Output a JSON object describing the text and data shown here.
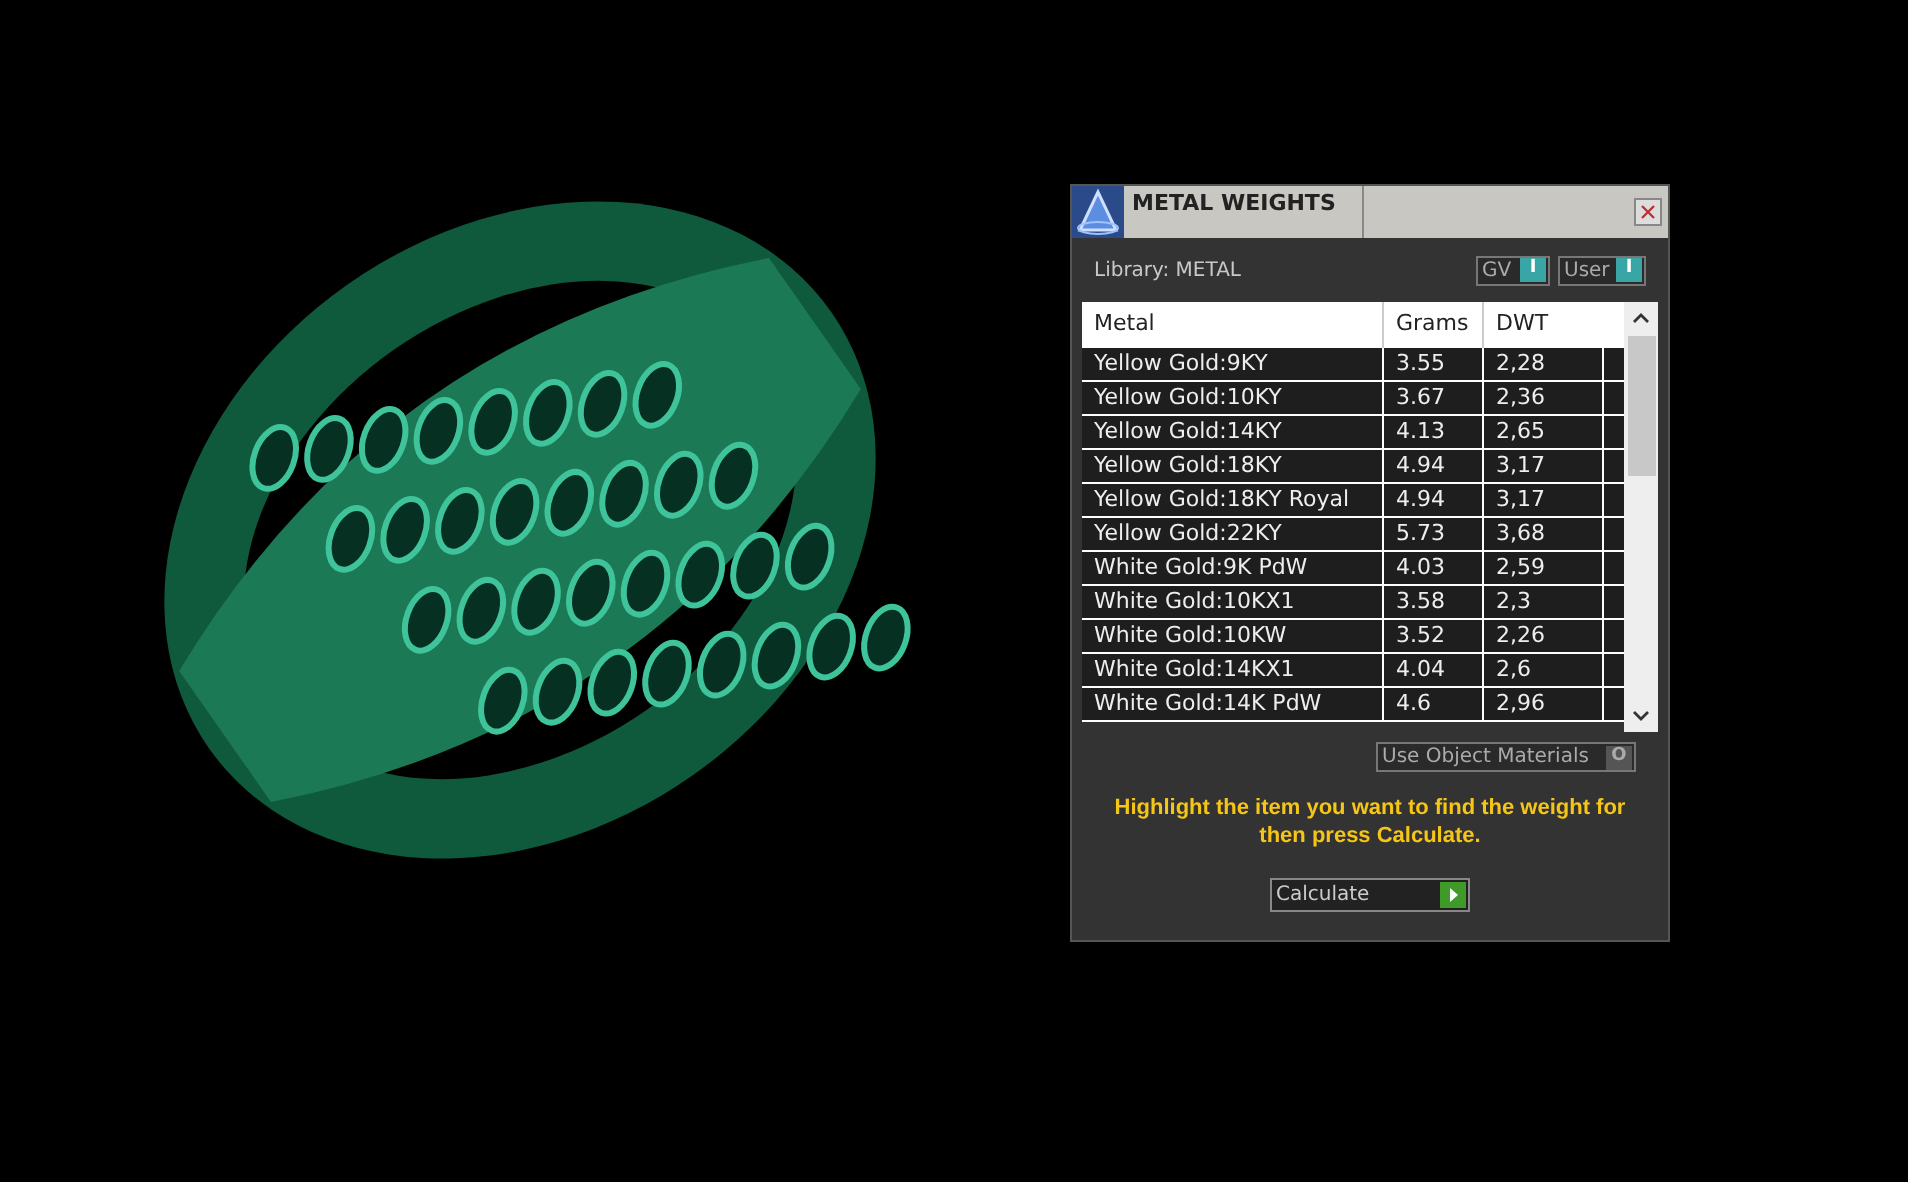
{
  "dialog": {
    "title": "METAL WEIGHTS",
    "library": "Library: METAL",
    "toggles": [
      {
        "label": "GV",
        "glyph": "I",
        "on": true
      },
      {
        "label": "User",
        "glyph": "I",
        "on": true
      }
    ],
    "table": {
      "columns": [
        "Metal",
        "Grams",
        "DWT"
      ],
      "rows": [
        {
          "metal": "Yellow Gold:9KY",
          "grams": "3.55",
          "dwt": "2,28"
        },
        {
          "metal": "Yellow Gold:10KY",
          "grams": "3.67",
          "dwt": "2,36"
        },
        {
          "metal": "Yellow Gold:14KY",
          "grams": "4.13",
          "dwt": "2,65"
        },
        {
          "metal": "Yellow Gold:18KY",
          "grams": "4.94",
          "dwt": "3,17"
        },
        {
          "metal": "Yellow Gold:18KY Royal",
          "grams": "4.94",
          "dwt": "3,17"
        },
        {
          "metal": "Yellow Gold:22KY",
          "grams": "5.73",
          "dwt": "3,68"
        },
        {
          "metal": "White Gold:9K PdW",
          "grams": "4.03",
          "dwt": "2,59"
        },
        {
          "metal": "White Gold:10KX1",
          "grams": "3.58",
          "dwt": "2,3"
        },
        {
          "metal": "White Gold:10KW",
          "grams": "3.52",
          "dwt": "2,26"
        },
        {
          "metal": "White Gold:14KX1",
          "grams": "4.04",
          "dwt": "2,6"
        },
        {
          "metal": "White Gold:14K PdW",
          "grams": "4.6",
          "dwt": "2,96"
        }
      ]
    },
    "use_object_materials": {
      "label": "Use Object Materials",
      "glyph": "O",
      "on": false
    },
    "hint": "Highlight the item you want to find the weight for then press Calculate.",
    "calculate_button": "Calculate"
  }
}
